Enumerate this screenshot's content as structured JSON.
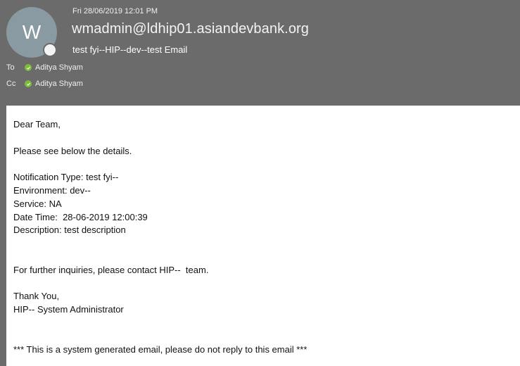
{
  "header": {
    "avatar_initial": "W",
    "date": "Fri 28/06/2019 12:01 PM",
    "sender": "wmadmin@ldhip01.asiandevbank.org",
    "subject": "test fyi--HIP--dev--test Email"
  },
  "recipients": {
    "to_label": "To",
    "to_name": "Aditya Shyam",
    "cc_label": "Cc",
    "cc_name": "Aditya Shyam"
  },
  "body": {
    "greeting": "Dear Team,",
    "intro": "Please see below the details.",
    "notification_type": "Notification Type: test fyi--",
    "environment": "Environment: dev--",
    "service": "Service: NA",
    "date_time": "Date Time:  28-06-2019 12:00:39",
    "description": "Description: test description",
    "inquiries": "For further inquiries, please contact HIP--  team.",
    "thanks": "Thank You,",
    "signature": "HIP-- System Administrator",
    "footer": "*** This is a system generated email, please do not reply to this email ***"
  },
  "colors": {
    "header_bg": "#6b6b6b",
    "avatar_bg": "#8a9aa3",
    "presence_check": "#7ebd3a",
    "body_bg": "#ffffff"
  }
}
